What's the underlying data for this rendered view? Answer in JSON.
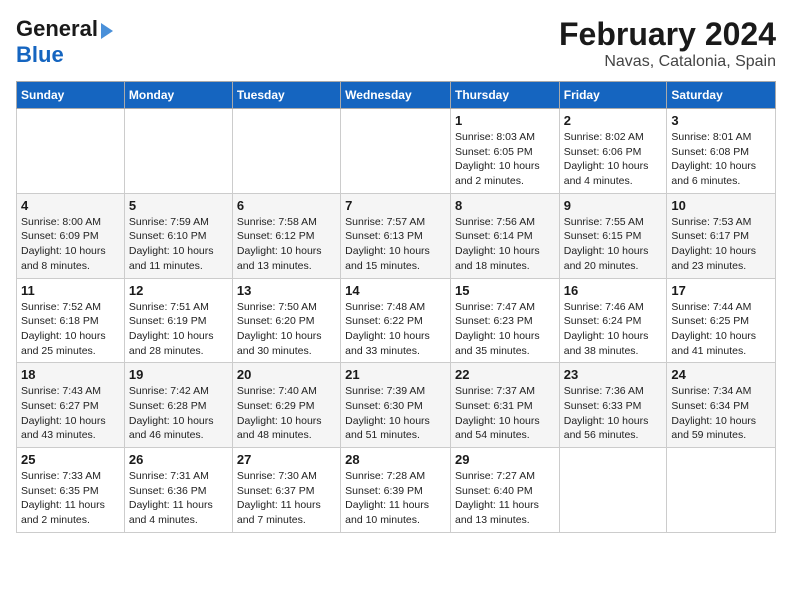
{
  "header": {
    "logo_line1": "General",
    "logo_line2": "Blue",
    "title": "February 2024",
    "subtitle": "Navas, Catalonia, Spain"
  },
  "days_of_week": [
    "Sunday",
    "Monday",
    "Tuesday",
    "Wednesday",
    "Thursday",
    "Friday",
    "Saturday"
  ],
  "weeks": [
    [
      {
        "num": "",
        "info": ""
      },
      {
        "num": "",
        "info": ""
      },
      {
        "num": "",
        "info": ""
      },
      {
        "num": "",
        "info": ""
      },
      {
        "num": "1",
        "info": "Sunrise: 8:03 AM\nSunset: 6:05 PM\nDaylight: 10 hours\nand 2 minutes."
      },
      {
        "num": "2",
        "info": "Sunrise: 8:02 AM\nSunset: 6:06 PM\nDaylight: 10 hours\nand 4 minutes."
      },
      {
        "num": "3",
        "info": "Sunrise: 8:01 AM\nSunset: 6:08 PM\nDaylight: 10 hours\nand 6 minutes."
      }
    ],
    [
      {
        "num": "4",
        "info": "Sunrise: 8:00 AM\nSunset: 6:09 PM\nDaylight: 10 hours\nand 8 minutes."
      },
      {
        "num": "5",
        "info": "Sunrise: 7:59 AM\nSunset: 6:10 PM\nDaylight: 10 hours\nand 11 minutes."
      },
      {
        "num": "6",
        "info": "Sunrise: 7:58 AM\nSunset: 6:12 PM\nDaylight: 10 hours\nand 13 minutes."
      },
      {
        "num": "7",
        "info": "Sunrise: 7:57 AM\nSunset: 6:13 PM\nDaylight: 10 hours\nand 15 minutes."
      },
      {
        "num": "8",
        "info": "Sunrise: 7:56 AM\nSunset: 6:14 PM\nDaylight: 10 hours\nand 18 minutes."
      },
      {
        "num": "9",
        "info": "Sunrise: 7:55 AM\nSunset: 6:15 PM\nDaylight: 10 hours\nand 20 minutes."
      },
      {
        "num": "10",
        "info": "Sunrise: 7:53 AM\nSunset: 6:17 PM\nDaylight: 10 hours\nand 23 minutes."
      }
    ],
    [
      {
        "num": "11",
        "info": "Sunrise: 7:52 AM\nSunset: 6:18 PM\nDaylight: 10 hours\nand 25 minutes."
      },
      {
        "num": "12",
        "info": "Sunrise: 7:51 AM\nSunset: 6:19 PM\nDaylight: 10 hours\nand 28 minutes."
      },
      {
        "num": "13",
        "info": "Sunrise: 7:50 AM\nSunset: 6:20 PM\nDaylight: 10 hours\nand 30 minutes."
      },
      {
        "num": "14",
        "info": "Sunrise: 7:48 AM\nSunset: 6:22 PM\nDaylight: 10 hours\nand 33 minutes."
      },
      {
        "num": "15",
        "info": "Sunrise: 7:47 AM\nSunset: 6:23 PM\nDaylight: 10 hours\nand 35 minutes."
      },
      {
        "num": "16",
        "info": "Sunrise: 7:46 AM\nSunset: 6:24 PM\nDaylight: 10 hours\nand 38 minutes."
      },
      {
        "num": "17",
        "info": "Sunrise: 7:44 AM\nSunset: 6:25 PM\nDaylight: 10 hours\nand 41 minutes."
      }
    ],
    [
      {
        "num": "18",
        "info": "Sunrise: 7:43 AM\nSunset: 6:27 PM\nDaylight: 10 hours\nand 43 minutes."
      },
      {
        "num": "19",
        "info": "Sunrise: 7:42 AM\nSunset: 6:28 PM\nDaylight: 10 hours\nand 46 minutes."
      },
      {
        "num": "20",
        "info": "Sunrise: 7:40 AM\nSunset: 6:29 PM\nDaylight: 10 hours\nand 48 minutes."
      },
      {
        "num": "21",
        "info": "Sunrise: 7:39 AM\nSunset: 6:30 PM\nDaylight: 10 hours\nand 51 minutes."
      },
      {
        "num": "22",
        "info": "Sunrise: 7:37 AM\nSunset: 6:31 PM\nDaylight: 10 hours\nand 54 minutes."
      },
      {
        "num": "23",
        "info": "Sunrise: 7:36 AM\nSunset: 6:33 PM\nDaylight: 10 hours\nand 56 minutes."
      },
      {
        "num": "24",
        "info": "Sunrise: 7:34 AM\nSunset: 6:34 PM\nDaylight: 10 hours\nand 59 minutes."
      }
    ],
    [
      {
        "num": "25",
        "info": "Sunrise: 7:33 AM\nSunset: 6:35 PM\nDaylight: 11 hours\nand 2 minutes."
      },
      {
        "num": "26",
        "info": "Sunrise: 7:31 AM\nSunset: 6:36 PM\nDaylight: 11 hours\nand 4 minutes."
      },
      {
        "num": "27",
        "info": "Sunrise: 7:30 AM\nSunset: 6:37 PM\nDaylight: 11 hours\nand 7 minutes."
      },
      {
        "num": "28",
        "info": "Sunrise: 7:28 AM\nSunset: 6:39 PM\nDaylight: 11 hours\nand 10 minutes."
      },
      {
        "num": "29",
        "info": "Sunrise: 7:27 AM\nSunset: 6:40 PM\nDaylight: 11 hours\nand 13 minutes."
      },
      {
        "num": "",
        "info": ""
      },
      {
        "num": "",
        "info": ""
      }
    ]
  ]
}
